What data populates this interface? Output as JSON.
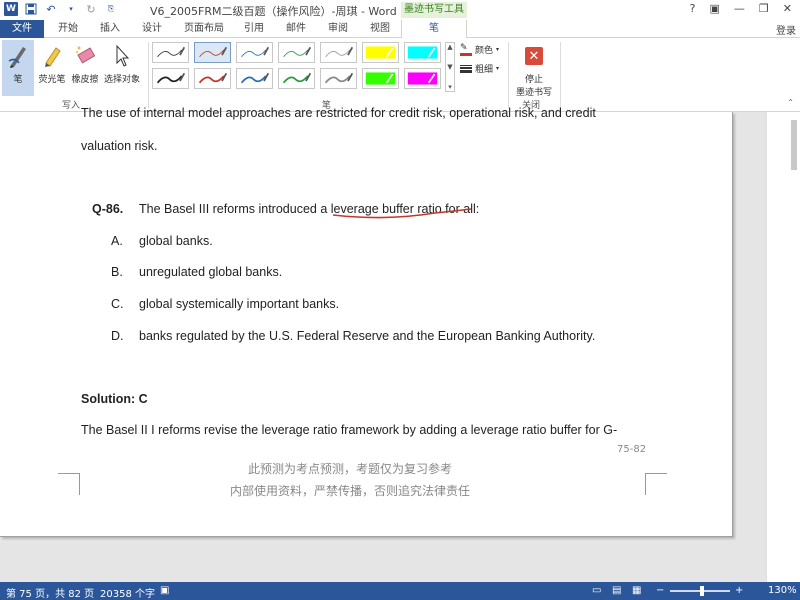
{
  "titlebar": {
    "app_icon": "W",
    "qat_icons": [
      "save-icon",
      "undo-icon",
      "redo-icon",
      "customize-icon"
    ],
    "title": "V6_2005FRM二级百题（操作风险）-周琪 - Word",
    "controls": [
      "?",
      "▣",
      "—",
      "❐",
      "✕"
    ]
  },
  "tabs": [
    {
      "label": "文件"
    },
    {
      "label": "开始"
    },
    {
      "label": "插入"
    },
    {
      "label": "设计"
    },
    {
      "label": "页面布局"
    },
    {
      "label": "引用"
    },
    {
      "label": "邮件"
    },
    {
      "label": "审阅"
    },
    {
      "label": "视图"
    },
    {
      "label": "笔"
    }
  ],
  "contextual_label": "墨迹书写工具",
  "login_label": "登录",
  "ribbon": {
    "write_group": {
      "label": "写入",
      "buttons": [
        {
          "label": "笔",
          "icon": "pen-icon"
        },
        {
          "label": "荧光笔",
          "icon": "highlighter-icon"
        },
        {
          "label": "橡皮擦",
          "icon": "eraser-icon"
        },
        {
          "label": "选择对象",
          "icon": "select-pointer-icon"
        }
      ]
    },
    "pen_group": {
      "label": "笔",
      "pens": [
        {
          "color": "#333333",
          "style": "thin"
        },
        {
          "color": "#c0392b",
          "style": "thin"
        },
        {
          "color": "#2e6db4",
          "style": "thin"
        },
        {
          "color": "#2e9b3e",
          "style": "thin"
        },
        {
          "color": "#999999",
          "style": "thin"
        },
        {
          "color": "#ffff00",
          "style": "highlight"
        },
        {
          "color": "#00ffff",
          "style": "highlight"
        },
        {
          "color": "#222222",
          "style": "thick"
        },
        {
          "color": "#c0392b",
          "style": "thick"
        },
        {
          "color": "#2e6db4",
          "style": "thick"
        },
        {
          "color": "#2e9b3e",
          "style": "thick"
        },
        {
          "color": "#888888",
          "style": "thick"
        },
        {
          "color": "#33ff00",
          "style": "highlight"
        },
        {
          "color": "#ff00ff",
          "style": "highlight"
        }
      ],
      "color_label": "颜色",
      "thickness_label": "粗细"
    },
    "close_group": {
      "label": "关闭",
      "stop_label_line1": "停止",
      "stop_label_line2": "墨迹书写"
    }
  },
  "document": {
    "line_top": "The use of internal model approaches are restricted for credit risk, operational risk, and credit",
    "line_valuation": "valuation risk.",
    "question_number": "Q-86.",
    "question_text": "The Basel III reforms introduced a leverage buffer ratio for all:",
    "options": [
      {
        "letter": "A.",
        "text": "global banks."
      },
      {
        "letter": "B.",
        "text": "unregulated global banks."
      },
      {
        "letter": "C.",
        "text": "global systemically important banks."
      },
      {
        "letter": "D.",
        "text": "banks regulated by the U.S. Federal Reserve and the European Banking Authority."
      }
    ],
    "solution_label": "Solution: C",
    "solution_text": "The Basel II I reforms revise the leverage ratio framework by adding a leverage ratio buffer for G-",
    "page_number": "75-82",
    "footer_line1": "此预测为考点预测，考题仅为复习参考",
    "footer_line2": "内部使用资料，严禁传播，否则追究法律责任",
    "annotation_color": "#c0392b"
  },
  "statusbar": {
    "page_info": "第 75 页，共 82 页",
    "word_count": "20358 个字",
    "zoom_label": "130%",
    "zoom_minus": "−",
    "zoom_plus": "+"
  }
}
